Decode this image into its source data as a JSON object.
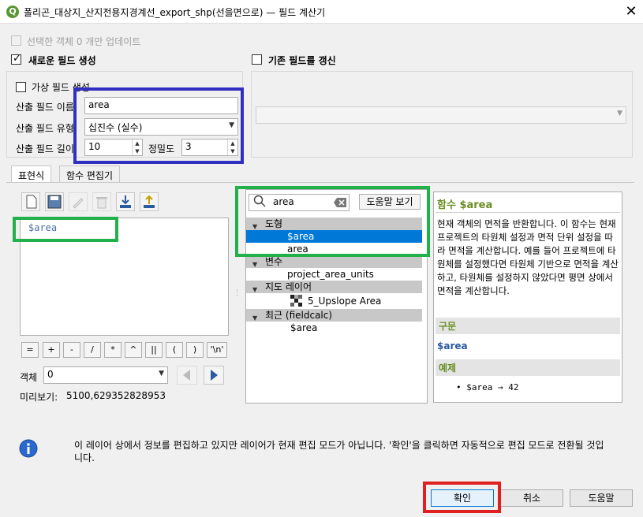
{
  "window": {
    "title": "폴리곤_대상지_산지전용지경계선_export_shp(선을면으로) — 필드 계산기",
    "close": "✕"
  },
  "top": {
    "update_selected": "선택한 객체 0 개만 업데이트",
    "new_field": "새로운 필드 생성",
    "update_existing": "기존 필드를 갱신"
  },
  "new_field_form": {
    "virtual": "가상 필드 생성",
    "name_label": "산출 필드 이름",
    "name_value": "area",
    "type_label": "산출 필드 유형",
    "type_value": "십진수 (실수)",
    "length_label": "산출 필드 길이",
    "length_value": "10",
    "precision_label": "정밀도",
    "precision_value": "3"
  },
  "tabs": [
    "표현식",
    "함수 편집기"
  ],
  "expression": "$area",
  "operators": [
    "=",
    "+",
    "-",
    "/",
    "*",
    "^",
    "||",
    "(",
    ")",
    "'\\n'"
  ],
  "feature": {
    "label": "객체",
    "value": "0"
  },
  "preview": {
    "label": "미리보기:",
    "value": "5100,629352828953"
  },
  "search": {
    "value": "area",
    "help_button": "도움말 보기"
  },
  "tree": [
    {
      "type": "header",
      "label": "도형"
    },
    {
      "type": "item",
      "label": "$area",
      "selected": true
    },
    {
      "type": "item",
      "label": "area"
    },
    {
      "type": "header",
      "label": "변수"
    },
    {
      "type": "item",
      "label": "project_area_units"
    },
    {
      "type": "header",
      "label": "지도 레이어"
    },
    {
      "type": "item",
      "label": "5_Upslope Area",
      "icon": true
    },
    {
      "type": "header",
      "label": "최근 (fieldcalc)"
    },
    {
      "type": "item",
      "label": "$area"
    }
  ],
  "help": {
    "title": "함수 $area",
    "description": "현재 객체의 면적을 반환합니다. 이 함수는 현재 프로젝트의 타원체 설정과 면적 단위 설정을 따라 면적을 계산합니다. 예를 들어 프로젝트에 타원체를 설정했다면 타원체 기반으로 면적을 계산하고, 타원체를 설정하지 않았다면 평면 상에서 면적을 계산합니다.",
    "syntax_header": "구문",
    "syntax": "$area",
    "examples_header": "예제",
    "example": "$area → 42"
  },
  "info_message": "이 레이어 상에서 정보를 편집하고 있지만 레이어가 현재 편집 모드가 아닙니다. '확인'을 클릭하면 자동적으로 편집 모드로 전환될 것입니다.",
  "buttons": {
    "ok": "확인",
    "cancel": "취소",
    "help": "도움말"
  },
  "colors": {
    "highlight_blue": "#3030c0",
    "highlight_green": "#22b04a",
    "highlight_red": "#e02020",
    "selection": "#0078d7",
    "help_accent": "#6b8e23"
  }
}
